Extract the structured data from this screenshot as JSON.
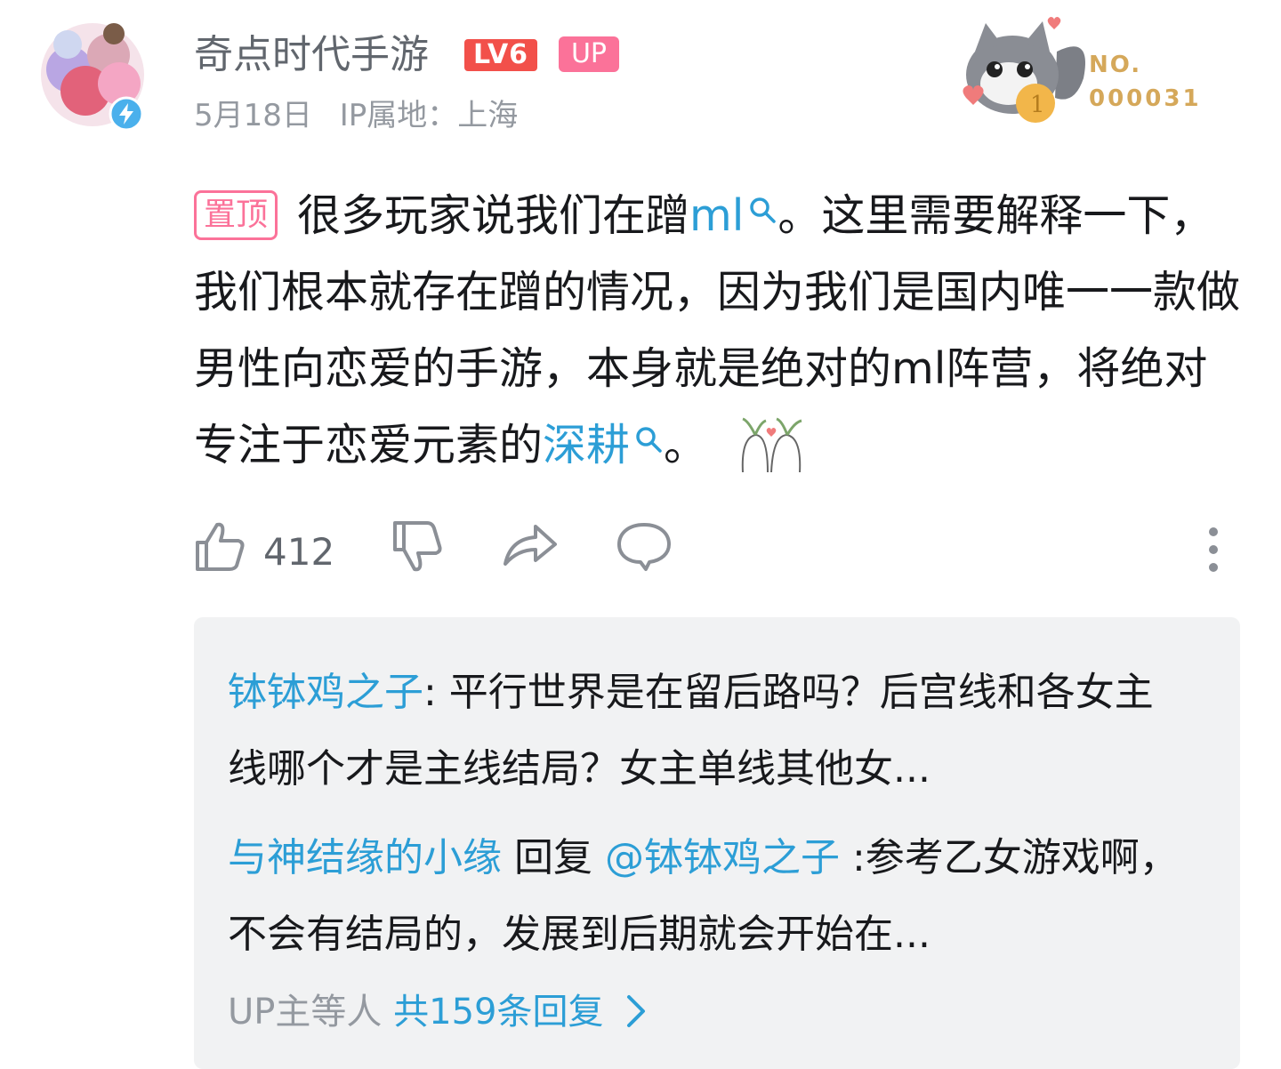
{
  "author": {
    "name": "奇点时代手游",
    "level_badge": "LV6",
    "up_badge": "UP",
    "date": "5月18日",
    "ip_location": "IP属地：上海"
  },
  "fan_badge": {
    "line1": "NO.",
    "line2": "000031"
  },
  "post": {
    "pin_label": "置顶",
    "text_1": "很多玩家说我们在蹭",
    "keyword_1": "ml",
    "text_2": "。这里需要解释一下，我们根本就存在蹭的情况，因为我们是国内唯一一款做男性向恋爱的手游，本身就是绝对的ml阵营，将绝对专注于恋爱元素的",
    "keyword_2": "深耕",
    "text_3": "。"
  },
  "actions": {
    "like_count": "412"
  },
  "replies": [
    {
      "user": "钵钵鸡之子",
      "text": ": 平行世界是在留后路吗？后宫线和各女主线哪个才是主线结局？女主单线其他女..."
    },
    {
      "user": "与神结缘的小缘",
      "reply_word": " 回复 ",
      "mention": "@钵钵鸡之子",
      "text": " :参考乙女游戏啊，不会有结局的，发展到后期就会开始在..."
    }
  ],
  "more_replies": {
    "prefix": "UP主等人 ",
    "link": "共159条回复"
  },
  "colors": {
    "link_blue": "#2c9ed6",
    "pink": "#fb7299",
    "level_red": "#f2504a",
    "gray_text": "#9499a0",
    "reply_bg": "#f1f2f3"
  },
  "icons": [
    "avatar-image",
    "verified-lightning-icon",
    "fan-badge-cat-image",
    "search-icon",
    "sticker-image",
    "thumbs-up-icon",
    "thumbs-down-icon",
    "share-icon",
    "comment-icon",
    "more-vertical-icon",
    "chevron-right-icon"
  ]
}
